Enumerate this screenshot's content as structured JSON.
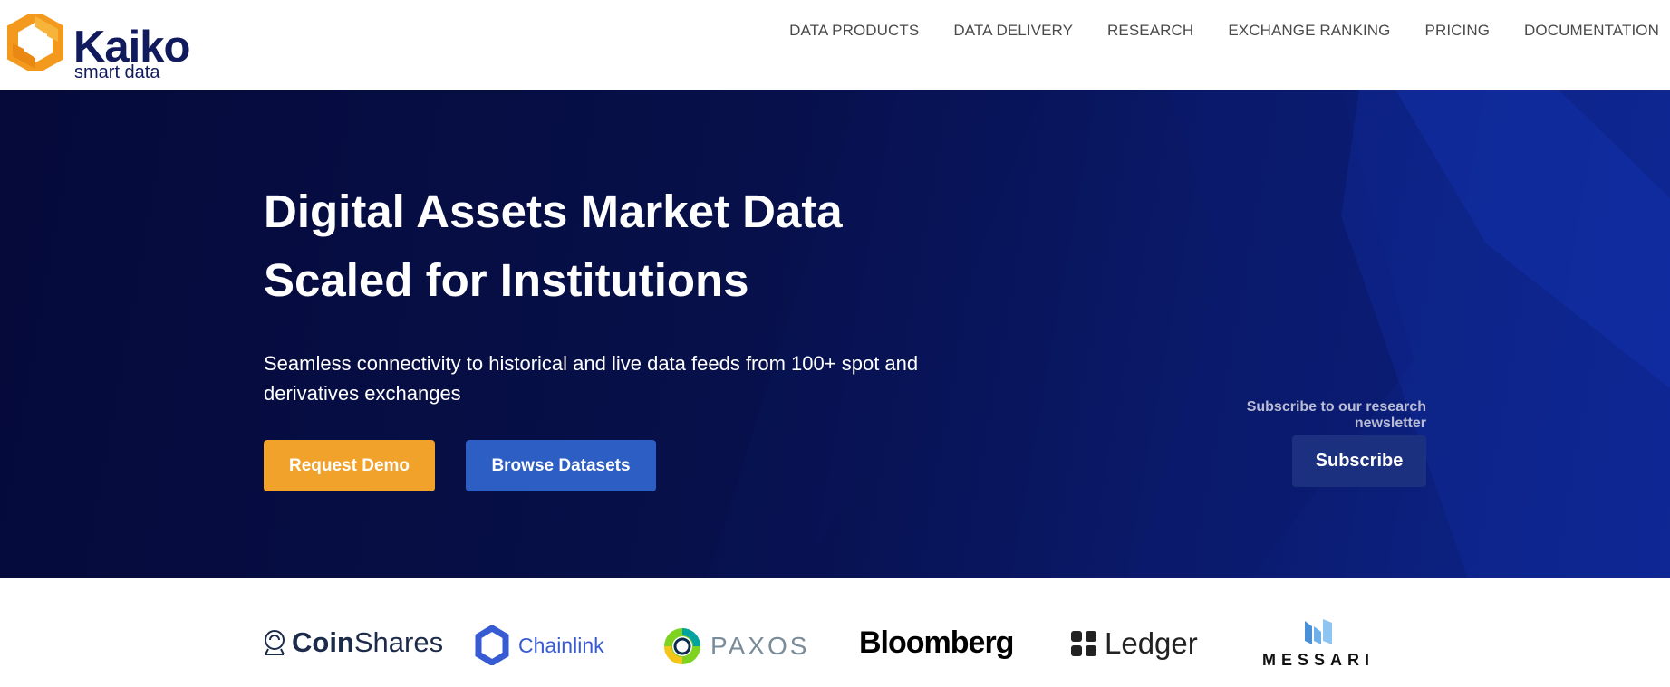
{
  "brand": {
    "name": "Kaiko",
    "tagline": "smart data"
  },
  "nav": {
    "items": [
      {
        "label": "DATA PRODUCTS"
      },
      {
        "label": "DATA DELIVERY"
      },
      {
        "label": "RESEARCH"
      },
      {
        "label": "EXCHANGE RANKING"
      },
      {
        "label": "PRICING"
      },
      {
        "label": "DOCUMENTATION"
      }
    ]
  },
  "hero": {
    "title_line1": "Digital Assets Market Data",
    "title_line2": "Scaled for Institutions",
    "subtitle": "Seamless connectivity to historical and live data feeds from 100+ spot and derivatives exchanges",
    "request_demo_label": "Request Demo",
    "browse_datasets_label": "Browse Datasets",
    "newsletter_label": "Subscribe to our research newsletter",
    "subscribe_label": "Subscribe"
  },
  "partners": [
    {
      "name_bold": "Coin",
      "name_rest": "Shares",
      "icon": "coinshares-icon"
    },
    {
      "name": "Chainlink",
      "icon": "chainlink-icon"
    },
    {
      "name": "PAXOS",
      "icon": "paxos-icon"
    },
    {
      "name": "Bloomberg"
    },
    {
      "name": "Ledger",
      "icon": "ledger-icon"
    },
    {
      "name": "MESSARI",
      "icon": "messari-icon"
    }
  ],
  "colors": {
    "brand_navy": "#101a5c",
    "brand_orange": "#f0a22b",
    "button_blue": "#2c5ec3",
    "subscribe_blue": "#1c3080",
    "hero_bg": "#07104a"
  }
}
